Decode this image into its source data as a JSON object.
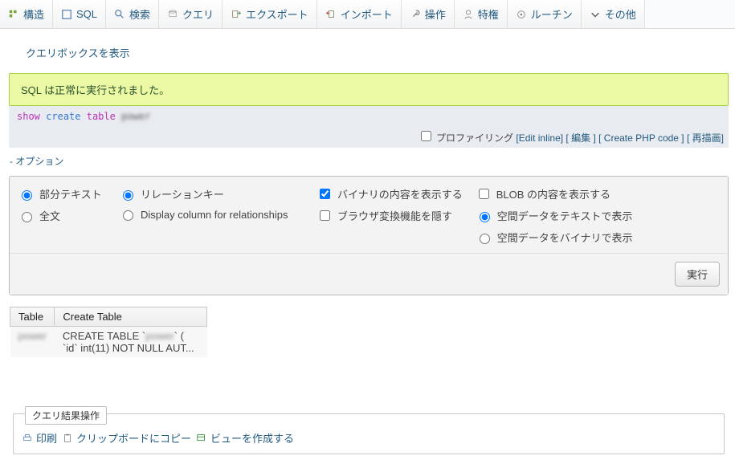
{
  "tabs": [
    {
      "label": "構造",
      "icon": "structure"
    },
    {
      "label": "SQL",
      "icon": "sql"
    },
    {
      "label": "検索",
      "icon": "search"
    },
    {
      "label": "クエリ",
      "icon": "query"
    },
    {
      "label": "エクスポート",
      "icon": "export"
    },
    {
      "label": "インポート",
      "icon": "import"
    },
    {
      "label": "操作",
      "icon": "wrench"
    },
    {
      "label": "特権",
      "icon": "user"
    },
    {
      "label": "ルーチン",
      "icon": "routine"
    },
    {
      "label": "その他",
      "icon": "more"
    }
  ],
  "show_query_link": "クエリボックスを表示",
  "success_message": "SQL は正常に実行されました。",
  "sql": {
    "kw_show": "show",
    "kw_create": "create",
    "kw_table": "table",
    "target": "power"
  },
  "toolbar": {
    "profiling": "プロファイリング",
    "edit_inline": "Edit inline",
    "edit": "編集",
    "create_php": "Create PHP code",
    "refresh": "再描画"
  },
  "options_link": "- オプション",
  "options": {
    "partial_text": "部分テキスト",
    "full_text": "全文",
    "relation_key": "リレーションキー",
    "display_col": "Display column for relationships",
    "show_binary": "バイナリの内容を表示する",
    "show_blob": "BLOB の内容を表示する",
    "hide_browser_conv": "ブラウザ変換機能を隠す",
    "geom_text": "空間データをテキストで表示",
    "geom_binary": "空間データをバイナリで表示"
  },
  "exec_button": "実行",
  "grid": {
    "headers": {
      "table": "Table",
      "create_table": "Create Table"
    },
    "row": {
      "table_name": "power",
      "ddl_line1": "CREATE TABLE `power` (",
      "ddl_line2": "  `id` int(11) NOT NULL AUT..."
    }
  },
  "footer": {
    "legend": "クエリ結果操作",
    "print": "印刷",
    "copy": "クリップボードにコピー",
    "create_view": "ビューを作成する"
  }
}
